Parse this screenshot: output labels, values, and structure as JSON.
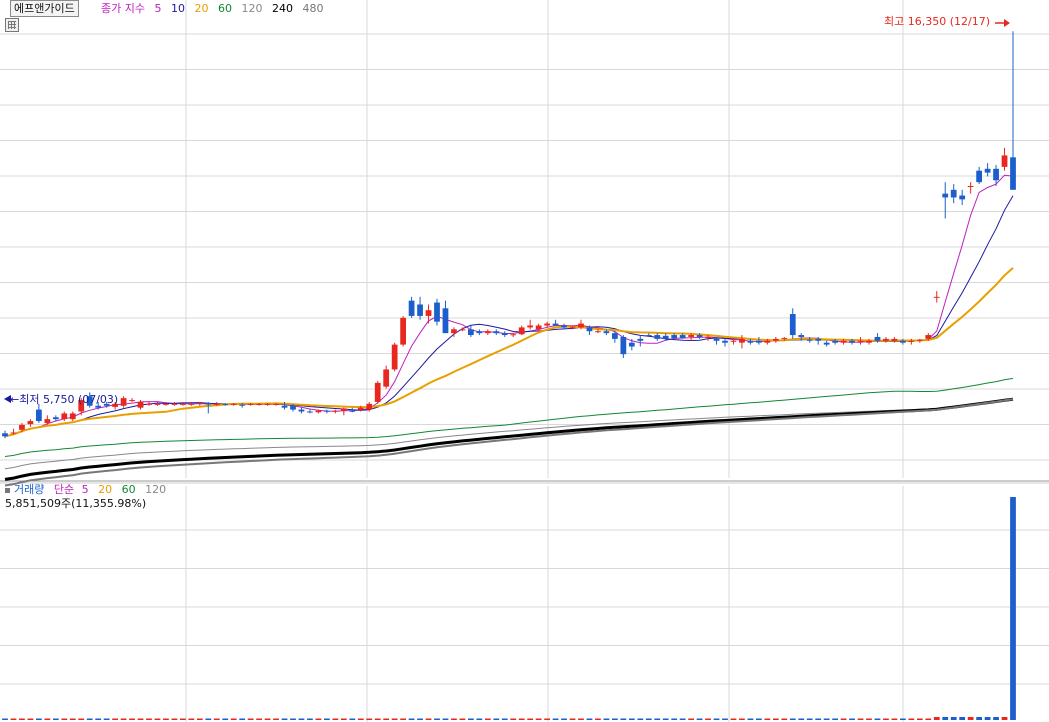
{
  "header": {
    "stock_name": "에프앤가이드",
    "price_legend": {
      "label": "종가 지수",
      "periods": [
        {
          "label": "5",
          "color": "#c020c0"
        },
        {
          "label": "10",
          "color": "#1a1aa0"
        },
        {
          "label": "20",
          "color": "#e8a000"
        },
        {
          "label": "60",
          "color": "#118833"
        },
        {
          "label": "120",
          "color": "#888888"
        },
        {
          "label": "240",
          "color": "#000000"
        },
        {
          "label": "480",
          "color": "#777777"
        }
      ]
    }
  },
  "price_annotations": {
    "high": "최고 16,350 (12/17)",
    "low": "←최저 5,750 (07/03)"
  },
  "volume_legend": {
    "label": "거래량",
    "ma_label": "단순",
    "periods": [
      {
        "label": "5",
        "color": "#c020c0"
      },
      {
        "label": "20",
        "color": "#e8a000"
      },
      {
        "label": "60",
        "color": "#118833"
      },
      {
        "label": "120",
        "color": "#888888"
      }
    ],
    "current_value": "5,851,509주(11,355.98%)"
  },
  "colors": {
    "up": "#e8281e",
    "down": "#1c5fcc",
    "grid": "#d8d8d8",
    "high_annotation": "#e8281e",
    "low_annotation": "#1a1aa0"
  },
  "chart_data": {
    "type": "candlestick",
    "price_range": [
      5000,
      16800
    ],
    "candles": [
      [
        5830,
        5900,
        5700,
        5750
      ],
      [
        5830,
        5950,
        5800,
        5850
      ],
      [
        5920,
        6100,
        5850,
        6050
      ],
      [
        6070,
        6200,
        6000,
        6150
      ],
      [
        6450,
        6600,
        6100,
        6150
      ],
      [
        6100,
        6300,
        6050,
        6200
      ],
      [
        6250,
        6300,
        6150,
        6200
      ],
      [
        6200,
        6400,
        6150,
        6350
      ],
      [
        6200,
        6400,
        6150,
        6350
      ],
      [
        6400,
        6750,
        6300,
        6700
      ],
      [
        6800,
        6900,
        6500,
        6550
      ],
      [
        6550,
        6650,
        6450,
        6500
      ],
      [
        6600,
        6650,
        6500,
        6550
      ],
      [
        6520,
        6650,
        6450,
        6600
      ],
      [
        6550,
        6800,
        6500,
        6750
      ],
      [
        6700,
        6750,
        6650,
        6700
      ],
      [
        6500,
        6700,
        6450,
        6650
      ],
      [
        6600,
        6650,
        6550,
        6600
      ],
      [
        6600,
        6650,
        6550,
        6600
      ],
      [
        6600,
        6650,
        6550,
        6600
      ],
      [
        6600,
        6650,
        6550,
        6600
      ],
      [
        6600,
        6650,
        6550,
        6600
      ],
      [
        6580,
        6650,
        6550,
        6600
      ],
      [
        6600,
        6650,
        6550,
        6620
      ],
      [
        6620,
        6650,
        6350,
        6580
      ],
      [
        6600,
        6650,
        6550,
        6600
      ],
      [
        6600,
        6620,
        6550,
        6580
      ],
      [
        6580,
        6620,
        6550,
        6600
      ],
      [
        6580,
        6620,
        6500,
        6550
      ],
      [
        6580,
        6620,
        6550,
        6600
      ],
      [
        6580,
        6620,
        6550,
        6600
      ],
      [
        6580,
        6620,
        6550,
        6600
      ],
      [
        6580,
        6620,
        6550,
        6600
      ],
      [
        6550,
        6650,
        6450,
        6500
      ],
      [
        6550,
        6600,
        6400,
        6450
      ],
      [
        6450,
        6500,
        6350,
        6400
      ],
      [
        6400,
        6450,
        6350,
        6380
      ],
      [
        6380,
        6450,
        6350,
        6420
      ],
      [
        6420,
        6450,
        6350,
        6400
      ],
      [
        6400,
        6450,
        6350,
        6420
      ],
      [
        6420,
        6500,
        6300,
        6480
      ],
      [
        6420,
        6500,
        6380,
        6400
      ],
      [
        6450,
        6550,
        6400,
        6500
      ],
      [
        6450,
        6650,
        6400,
        6600
      ],
      [
        6650,
        7200,
        6600,
        7150
      ],
      [
        7050,
        7600,
        7000,
        7500
      ],
      [
        7500,
        8200,
        7450,
        8150
      ],
      [
        8150,
        8900,
        8100,
        8850
      ],
      [
        9300,
        9400,
        8850,
        8900
      ],
      [
        9200,
        9400,
        8800,
        8900
      ],
      [
        8900,
        9200,
        8700,
        9050
      ],
      [
        9250,
        9350,
        8650,
        8750
      ],
      [
        9100,
        9300,
        8450,
        8450
      ],
      [
        8450,
        8600,
        8350,
        8550
      ],
      [
        8550,
        8600,
        8500,
        8550
      ],
      [
        8550,
        8650,
        8350,
        8400
      ],
      [
        8500,
        8550,
        8400,
        8450
      ],
      [
        8450,
        8550,
        8400,
        8500
      ],
      [
        8500,
        8550,
        8400,
        8450
      ],
      [
        8450,
        8500,
        8350,
        8400
      ],
      [
        8400,
        8450,
        8350,
        8420
      ],
      [
        8420,
        8650,
        8400,
        8600
      ],
      [
        8600,
        8800,
        8550,
        8650
      ],
      [
        8550,
        8700,
        8500,
        8650
      ],
      [
        8650,
        8750,
        8600,
        8700
      ],
      [
        8700,
        8800,
        8650,
        8650
      ],
      [
        8650,
        8700,
        8550,
        8600
      ],
      [
        8600,
        8650,
        8550,
        8620
      ],
      [
        8600,
        8800,
        8550,
        8700
      ],
      [
        8600,
        8650,
        8400,
        8500
      ],
      [
        8500,
        8550,
        8450,
        8500
      ],
      [
        8500,
        8550,
        8400,
        8450
      ],
      [
        8450,
        8500,
        8200,
        8300
      ],
      [
        8350,
        8400,
        7800,
        7900
      ],
      [
        8200,
        8300,
        8000,
        8100
      ],
      [
        8300,
        8400,
        8100,
        8250
      ],
      [
        8400,
        8450,
        8350,
        8380
      ],
      [
        8400,
        8450,
        8250,
        8300
      ],
      [
        8380,
        8450,
        8250,
        8300
      ],
      [
        8400,
        8450,
        8300,
        8320
      ],
      [
        8400,
        8450,
        8300,
        8320
      ],
      [
        8350,
        8450,
        8250,
        8400
      ],
      [
        8400,
        8450,
        8300,
        8350
      ],
      [
        8350,
        8400,
        8250,
        8350
      ],
      [
        8300,
        8350,
        8150,
        8250
      ],
      [
        8250,
        8300,
        8100,
        8200
      ],
      [
        8250,
        8300,
        8150,
        8250
      ],
      [
        8200,
        8400,
        8050,
        8300
      ],
      [
        8250,
        8300,
        8150,
        8200
      ],
      [
        8250,
        8350,
        8150,
        8200
      ],
      [
        8200,
        8300,
        8150,
        8250
      ],
      [
        8250,
        8350,
        8200,
        8300
      ],
      [
        8300,
        8350,
        8250,
        8320
      ],
      [
        8950,
        9100,
        8300,
        8400
      ],
      [
        8400,
        8450,
        8250,
        8350
      ],
      [
        8280,
        8350,
        8200,
        8250
      ],
      [
        8300,
        8350,
        8150,
        8250
      ],
      [
        8200,
        8250,
        8100,
        8150
      ],
      [
        8250,
        8300,
        8150,
        8200
      ],
      [
        8200,
        8300,
        8150,
        8250
      ],
      [
        8250,
        8300,
        8150,
        8200
      ],
      [
        8250,
        8350,
        8150,
        8250
      ],
      [
        8200,
        8300,
        8150,
        8250
      ],
      [
        8350,
        8450,
        8200,
        8250
      ],
      [
        8250,
        8350,
        8200,
        8300
      ],
      [
        8250,
        8350,
        8200,
        8300
      ],
      [
        8250,
        8300,
        8150,
        8200
      ],
      [
        8220,
        8300,
        8150,
        8250
      ],
      [
        8250,
        8300,
        8200,
        8280
      ],
      [
        8300,
        8450,
        8250,
        8400
      ],
      [
        9400,
        9550,
        9250,
        9400
      ],
      [
        12100,
        12400,
        11450,
        12000
      ],
      [
        12200,
        12350,
        11850,
        12000
      ],
      [
        12050,
        12200,
        11800,
        11950
      ],
      [
        12300,
        12400,
        12100,
        12300
      ],
      [
        12700,
        12800,
        12350,
        12400
      ],
      [
        12750,
        12900,
        12550,
        12650
      ],
      [
        12750,
        12850,
        12300,
        12450
      ],
      [
        12800,
        13300,
        12700,
        13100
      ],
      [
        13050,
        16350,
        12500,
        12200
      ]
    ],
    "volume": {
      "label": "거래량",
      "last_value": 5851509,
      "last_change_pct": 11355.98
    }
  }
}
